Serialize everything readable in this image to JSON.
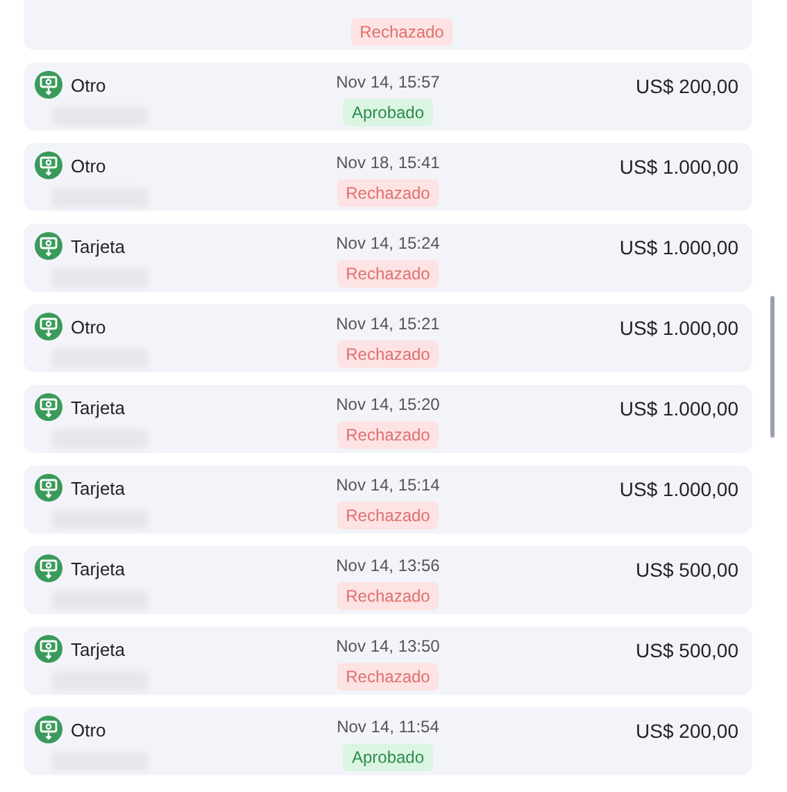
{
  "transactions": [
    {
      "partial": true,
      "status": "Rechazado",
      "kind": "rejected"
    },
    {
      "method": "Otro",
      "date": "Nov 14, 15:57",
      "status": "Aprobado",
      "kind": "approved",
      "amount": "US$ 200,00"
    },
    {
      "method": "Otro",
      "date": "Nov 18, 15:41",
      "status": "Rechazado",
      "kind": "rejected",
      "amount": "US$ 1.000,00"
    },
    {
      "method": "Tarjeta",
      "date": "Nov 14, 15:24",
      "status": "Rechazado",
      "kind": "rejected",
      "amount": "US$ 1.000,00"
    },
    {
      "method": "Otro",
      "date": "Nov 14, 15:21",
      "status": "Rechazado",
      "kind": "rejected",
      "amount": "US$ 1.000,00"
    },
    {
      "method": "Tarjeta",
      "date": "Nov 14, 15:20",
      "status": "Rechazado",
      "kind": "rejected",
      "amount": "US$ 1.000,00"
    },
    {
      "method": "Tarjeta",
      "date": "Nov 14, 15:14",
      "status": "Rechazado",
      "kind": "rejected",
      "amount": "US$ 1.000,00"
    },
    {
      "method": "Tarjeta",
      "date": "Nov 14, 13:56",
      "status": "Rechazado",
      "kind": "rejected",
      "amount": "US$ 500,00"
    },
    {
      "method": "Tarjeta",
      "date": "Nov 14, 13:50",
      "status": "Rechazado",
      "kind": "rejected",
      "amount": "US$ 500,00"
    },
    {
      "method": "Otro",
      "date": "Nov 14, 11:54",
      "status": "Aprobado",
      "kind": "approved",
      "amount": "US$ 200,00"
    }
  ]
}
